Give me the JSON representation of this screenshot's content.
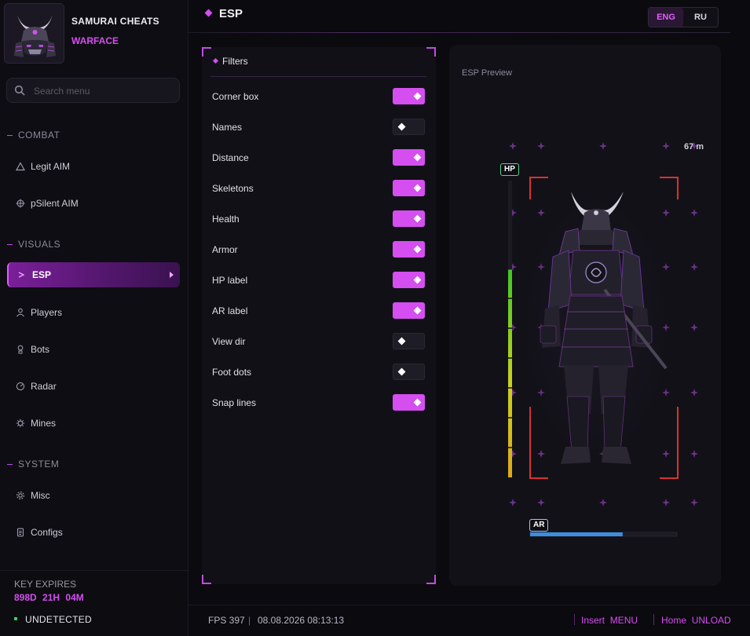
{
  "brand": {
    "title": "SAMURAI CHEATS",
    "subtitle": "WARFACE",
    "logo_icon": "samurai-helmet-logo"
  },
  "search": {
    "placeholder": "Search menu",
    "value": ""
  },
  "nav": {
    "sections": [
      {
        "label": "COMBAT",
        "items": [
          {
            "label": "Legit AIM",
            "icon": "triangle-icon"
          },
          {
            "label": "pSilent AIM",
            "icon": "crosshair-icon"
          }
        ]
      },
      {
        "label": "VISUALS",
        "items": [
          {
            "label": "ESP",
            "icon": "chevron-right-icon",
            "active": true
          },
          {
            "label": "Players",
            "icon": "user-icon"
          },
          {
            "label": "Bots",
            "icon": "bot-icon"
          },
          {
            "label": "Radar",
            "icon": "radar-icon"
          },
          {
            "label": "Mines",
            "icon": "mine-icon"
          }
        ]
      },
      {
        "label": "SYSTEM",
        "items": [
          {
            "label": "Misc",
            "icon": "gear-icon"
          },
          {
            "label": "Configs",
            "icon": "file-icon"
          }
        ]
      }
    ]
  },
  "footer_left": {
    "key_label": "KEY EXPIRES",
    "key_days": "898D",
    "key_hours": "21H",
    "key_minutes": "04M",
    "status": "UNDETECTED",
    "status_color": "#3ad468"
  },
  "header": {
    "title": "ESP",
    "languages": [
      {
        "label": "ENG",
        "active": true
      },
      {
        "label": "RU",
        "active": false
      }
    ]
  },
  "filters": {
    "title": "Filters",
    "items": [
      {
        "label": "Corner box",
        "on": true
      },
      {
        "label": "Names",
        "on": false
      },
      {
        "label": "Distance",
        "on": true
      },
      {
        "label": "Skeletons",
        "on": true
      },
      {
        "label": "Health",
        "on": true
      },
      {
        "label": "Armor",
        "on": true
      },
      {
        "label": "HP label",
        "on": true
      },
      {
        "label": "AR label",
        "on": true
      },
      {
        "label": "View dir",
        "on": false
      },
      {
        "label": "Foot dots",
        "on": false
      },
      {
        "label": "Snap lines",
        "on": true
      }
    ]
  },
  "preview": {
    "title": "ESP Preview",
    "distance": "67 m",
    "hp_label": "HP",
    "ar_label": "AR",
    "hp_fraction": 0.7,
    "ar_fraction": 0.63,
    "box_color": "#d8322e",
    "accent": "#d54ef0"
  },
  "status_bar": {
    "fps": "FPS 397",
    "separator": "|",
    "datetime": "08.08.2026 08:13:13",
    "hotkeys": [
      {
        "key": "Insert",
        "action": "MENU"
      },
      {
        "key": "Home",
        "action": "UNLOAD"
      }
    ]
  }
}
